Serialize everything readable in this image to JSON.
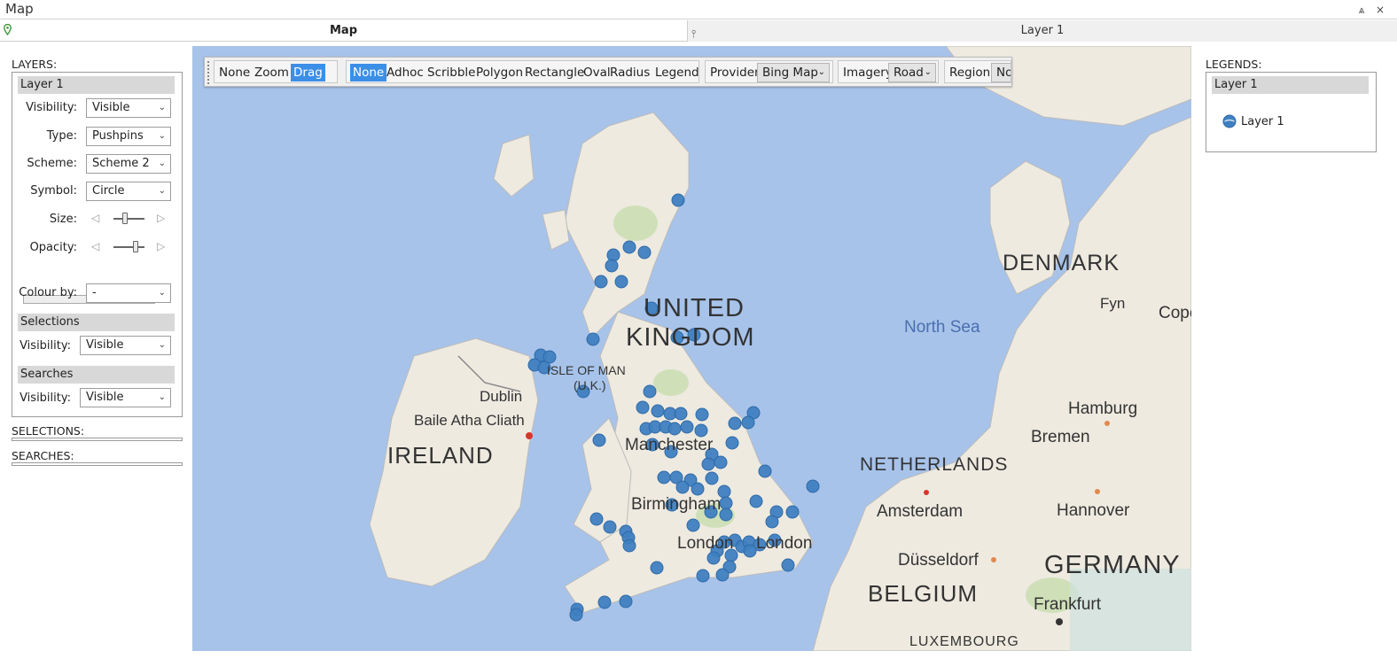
{
  "window": {
    "title": "Map",
    "pin_glyph": "⩓",
    "close_glyph": "×"
  },
  "tabs": {
    "map_label": "Map",
    "layer_label": "Layer 1"
  },
  "left_panel": {
    "layers_label": "LAYERS:",
    "layer_name": "Layer 1",
    "visibility_label": "Visibility:",
    "visibility_value": "Visible",
    "type_label": "Type:",
    "type_value": "Pushpins",
    "scheme_label": "Scheme:",
    "scheme_value": "Scheme 2",
    "symbol_label": "Symbol:",
    "symbol_value": "Circle",
    "size_label": "Size:",
    "size_level": 0.35,
    "opacity_label": "Opacity:",
    "opacity_level": 0.75,
    "colour_by_label": "Colour by:",
    "colour_by_value": "-",
    "selections_header": "Selections",
    "selections_visibility_label": "Visibility:",
    "selections_visibility_value": "Visible",
    "searches_header": "Searches",
    "searches_visibility_label": "Visibility:",
    "searches_visibility_value": "Visible",
    "selections_label": "SELECTIONS:",
    "searches_label": "SEARCHES:",
    "clear_glyph": "×"
  },
  "toolbar": {
    "mode_none": "None",
    "mode_zoom": "Zoom",
    "mode_drag": "Drag",
    "sel_none": "None",
    "sel_adhoc": "Adhoc",
    "sel_scribble": "Scribble",
    "sel_polygon": "Polygon",
    "sel_rectangle": "Rectangle",
    "sel_oval": "Oval",
    "sel_radius": "Radius",
    "sel_legend": "Legend",
    "provider_label": "Provider",
    "provider_value": "Bing Map",
    "imagery_label": "Imagery",
    "imagery_value": "Road",
    "region_label": "Region",
    "region_value": "No",
    "active_color": "#3c8fe6"
  },
  "map": {
    "labels": {
      "uk_1": "UNITED",
      "uk_2": "KINGDOM",
      "ireland": "IRELAND",
      "dublin": "Dublin",
      "baile": "Baile Atha Cliath",
      "isle_of_man": "ISLE OF MAN",
      "uk_abbr": "(U.K.)",
      "manchester": "Manchester",
      "birmingham": "Birmingham",
      "london": "London",
      "london2": "London",
      "denmark": "DENMARK",
      "fyn": "Fyn",
      "copen": "Copen",
      "north_sea": "North Sea",
      "hamburg": "Hamburg",
      "bremen": "Bremen",
      "netherlands": "NETHERLANDS",
      "amsterdam": "Amsterdam",
      "hannover": "Hannover",
      "dusseldorf": "Düsseldorf",
      "germany": "GERMANY",
      "belgium": "BELGIUM",
      "frankfurt": "Frankfurt",
      "luxembourg": "LUXEMBOURG"
    },
    "sea_color": "#a7c3ea",
    "land_color": "#f2efe6",
    "pin_color": "#3f7fc0"
  },
  "legend_panel": {
    "legends_label": "LEGENDS:",
    "layer_name": "Layer 1",
    "entry_label": "Layer 1"
  }
}
